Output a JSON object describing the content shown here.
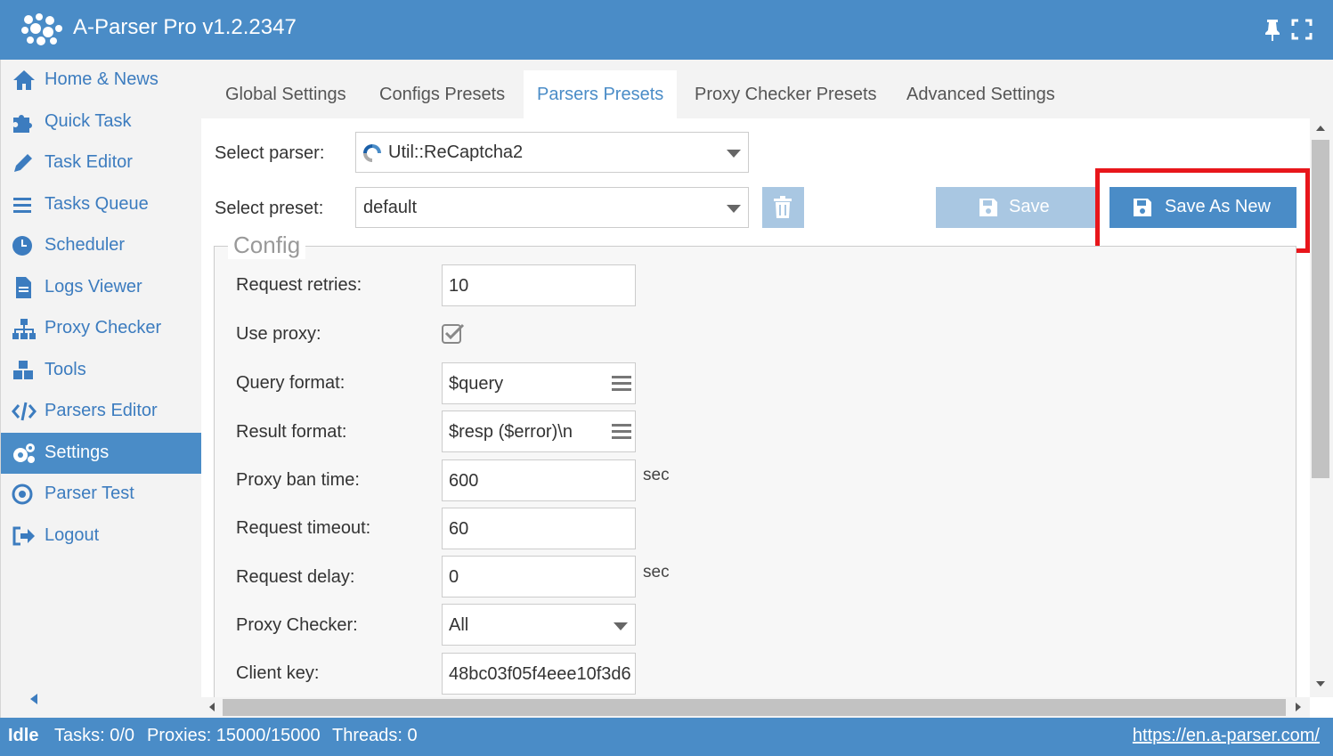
{
  "app": {
    "title": "A-Parser Pro v1.2.2347"
  },
  "colors": {
    "accent": "#4a8cc7",
    "highlight": "#e8161b",
    "disabled": "#a9c7e2"
  },
  "sidebar": {
    "items": [
      {
        "label": "Home & News",
        "icon": "home-icon"
      },
      {
        "label": "Quick Task",
        "icon": "puzzle-icon"
      },
      {
        "label": "Task Editor",
        "icon": "pencil-icon"
      },
      {
        "label": "Tasks Queue",
        "icon": "list-icon"
      },
      {
        "label": "Scheduler",
        "icon": "clock-icon"
      },
      {
        "label": "Logs Viewer",
        "icon": "file-icon"
      },
      {
        "label": "Proxy Checker",
        "icon": "sitemap-icon"
      },
      {
        "label": "Tools",
        "icon": "cubes-icon"
      },
      {
        "label": "Parsers Editor",
        "icon": "code-icon"
      },
      {
        "label": "Settings",
        "icon": "gears-icon",
        "active": true
      },
      {
        "label": "Parser Test",
        "icon": "target-icon"
      },
      {
        "label": "Logout",
        "icon": "sign-out-icon"
      }
    ]
  },
  "tabs": [
    {
      "label": "Global Settings"
    },
    {
      "label": "Configs Presets"
    },
    {
      "label": "Parsers Presets",
      "active": true
    },
    {
      "label": "Proxy Checker Presets"
    },
    {
      "label": "Advanced Settings"
    }
  ],
  "form": {
    "parser_label": "Select parser:",
    "parser_value": "Util::ReCaptcha2",
    "preset_label": "Select preset:",
    "preset_value": "default",
    "save_label": "Save",
    "save_as_new_label": "Save As New"
  },
  "config": {
    "legend": "Config",
    "fields": {
      "request_retries": {
        "label": "Request retries:",
        "value": "10"
      },
      "use_proxy": {
        "label": "Use proxy:",
        "checked": true
      },
      "query_format": {
        "label": "Query format:",
        "value": "$query"
      },
      "result_format": {
        "label": "Result format:",
        "value": "$resp ($error)\\n"
      },
      "proxy_ban_time": {
        "label": "Proxy ban time:",
        "value": "600",
        "unit": "sec"
      },
      "request_timeout": {
        "label": "Request timeout:",
        "value": "60"
      },
      "request_delay": {
        "label": "Request delay:",
        "value": "0",
        "unit": "sec"
      },
      "proxy_checker": {
        "label": "Proxy Checker:",
        "value": "All"
      },
      "client_key": {
        "label": "Client key:",
        "value": "48bc03f05f4eee10f3d6"
      }
    }
  },
  "status": {
    "state": "Idle",
    "tasks": "Tasks: 0/0",
    "proxies": "Proxies: 15000/15000",
    "threads": "Threads: 0",
    "link": "https://en.a-parser.com/"
  }
}
